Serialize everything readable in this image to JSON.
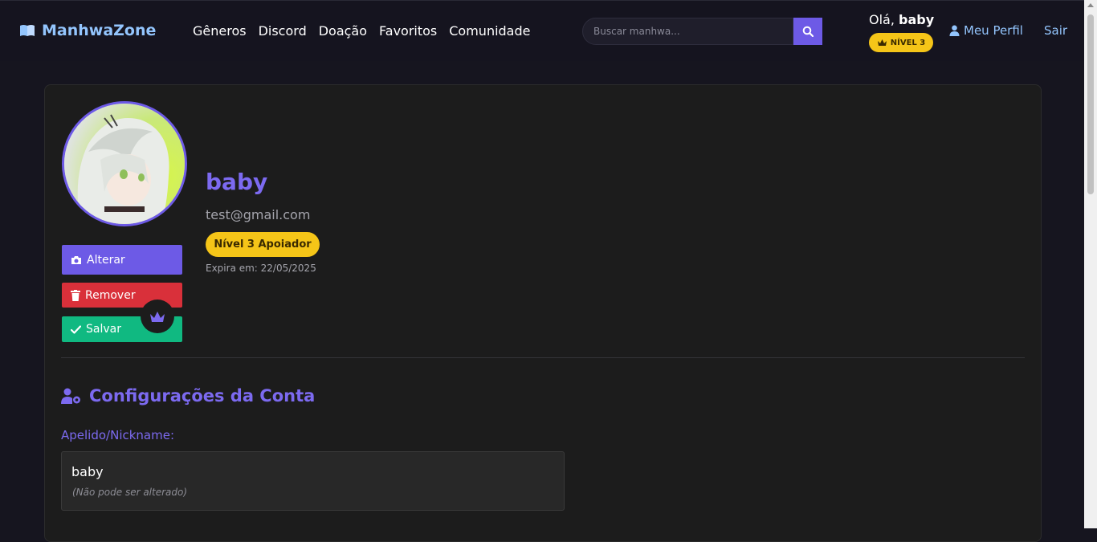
{
  "brand": {
    "name": "ManhwaZone"
  },
  "nav": {
    "links": [
      "Gêneros",
      "Discord",
      "Doação",
      "Favoritos",
      "Comunidade"
    ]
  },
  "search": {
    "placeholder": "Buscar manhwa..."
  },
  "user": {
    "greeting_prefix": "Olá,",
    "name": "baby",
    "level_badge": "NÍVEL 3",
    "profile_link": "Meu Perfil",
    "logout_link": "Sair"
  },
  "profile": {
    "username": "baby",
    "email": "test@gmail.com",
    "supporter_badge": "Nível 3 Apoiador",
    "expires": "Expira em: 22/05/2025",
    "buttons": {
      "change": "Alterar",
      "remove": "Remover",
      "save": "Salvar"
    }
  },
  "settings": {
    "title": "Configurações da Conta",
    "nickname_label": "Apelido/Nickname:",
    "nickname_value": "baby",
    "nickname_hint": "(Não pode ser alterado)"
  },
  "colors": {
    "accent": "#6d5ae6",
    "accent_text": "#7c6af0",
    "link": "#93c5fd",
    "gold": "#f5c518",
    "danger": "#d9303a",
    "success": "#10b981"
  }
}
